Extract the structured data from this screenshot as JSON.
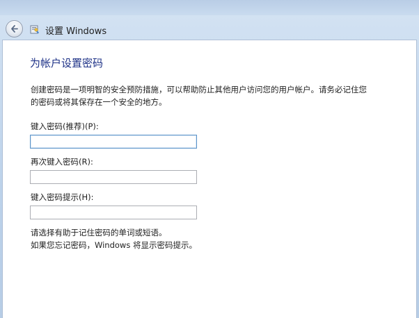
{
  "window": {
    "title": "设置 Windows",
    "back_icon": "back-arrow-icon",
    "app_icon": "windows-setup-icon"
  },
  "page": {
    "heading": "为帐户设置密码",
    "description_lines": [
      "创建密码是一项明智的安全预防措施，可以帮助防止其他用户访问您的用户帐户。请务必记住您",
      "的密码或将其保存在一个安全的地方。"
    ]
  },
  "fields": {
    "password": {
      "label": "键入密码(推荐)(P):",
      "value": ""
    },
    "confirm": {
      "label": "再次键入密码(R):",
      "value": ""
    },
    "hint": {
      "label": "键入密码提示(H):",
      "value": ""
    }
  },
  "hint_text_lines": [
    "请选择有助于记住密码的单词或短语。",
    "如果您忘记密码，Windows 将显示密码提示。"
  ],
  "colors": {
    "heading": "#1e3287",
    "input_border": "#abadb3",
    "focus_border": "#5b94c9"
  }
}
